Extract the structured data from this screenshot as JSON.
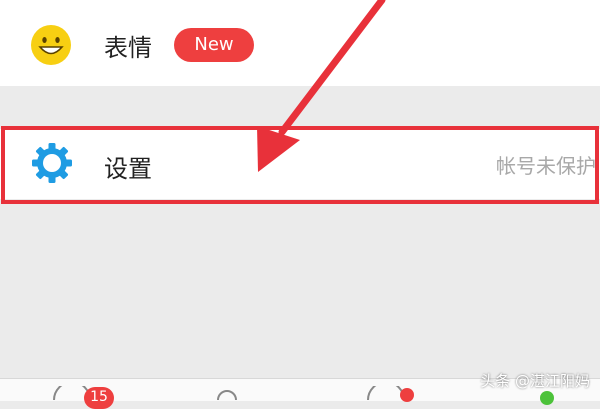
{
  "menu": {
    "emoji_row": {
      "label": "表情",
      "badge": "New",
      "icon": "smiley-face-icon"
    },
    "settings_row": {
      "label": "设置",
      "secondary": "帐号未保护",
      "icon": "gear-icon"
    }
  },
  "tabbar": {
    "badge_count": "15"
  },
  "watermark": "头条 @湛江阳妈",
  "colors": {
    "accent_red": "#e8313a",
    "badge_red": "#ee3f3f",
    "emoji_yellow": "#f7cf12",
    "gear_blue": "#1f9ce3",
    "background": "#ebebeb",
    "secondary_text": "#a8a8a8"
  }
}
